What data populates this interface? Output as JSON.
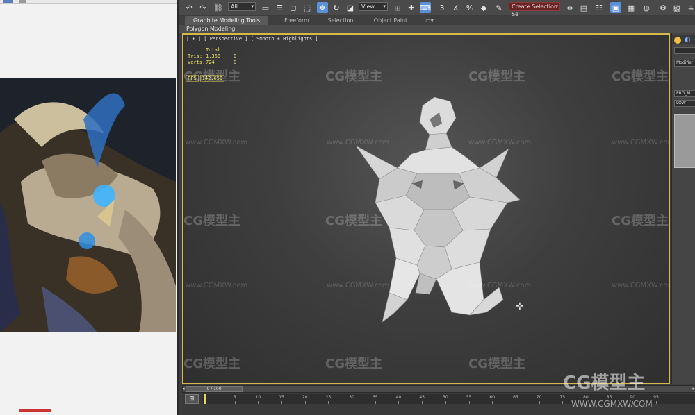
{
  "toolbar": {
    "selection_filter": "All",
    "reference_coord": "View",
    "named_selection": "Create Selection Se"
  },
  "ribbon": {
    "tabs": [
      {
        "label": "Graphite Modeling Tools",
        "active": true
      },
      {
        "label": "Freeform",
        "active": false
      },
      {
        "label": "Selection",
        "active": false
      },
      {
        "label": "Object Paint",
        "active": false
      }
    ],
    "panel_label": "Polygon Modeling"
  },
  "viewport": {
    "label": "[ + ] [ Perspective ] [ Smooth + Highlights ]",
    "stats": {
      "header": "Total",
      "tris_label": "Tris:",
      "tris_value": "1,368",
      "tris_sel": "0",
      "verts_label": "Verts:",
      "verts_value": "724",
      "verts_sel": "0"
    },
    "fps": [
      "FPS",
      "142.650"
    ]
  },
  "command_panel": {
    "modifier_list": "Modifier Lis",
    "field_1": "PRG_M",
    "field_2": "LOW_"
  },
  "timeline": {
    "frame_counter": "0 / 100",
    "ticks": [
      "5",
      "10",
      "15",
      "20",
      "25",
      "30",
      "35",
      "40",
      "45",
      "50",
      "55",
      "60",
      "65",
      "70",
      "75",
      "80",
      "85",
      "90",
      "95"
    ]
  },
  "watermark": {
    "brand": "CG模型主",
    "url": "www.CGMXW.com",
    "url_large": "WWW.CGMXW.COM"
  },
  "colors": {
    "viewport_border": "#d4b84a",
    "stats_text": "#f2e86a",
    "active_tool": "#5b8fd8"
  }
}
